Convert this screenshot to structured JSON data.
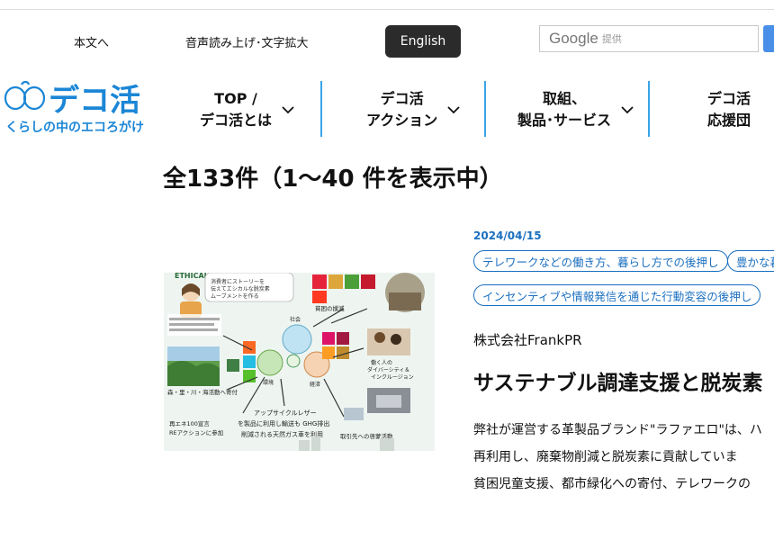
{
  "utility": {
    "skip_link": "本文へ",
    "accessibility_link": "音声読み上げ･文字拡大",
    "english_button": "English",
    "search_brand": "Google",
    "search_suffix": "提供"
  },
  "logo": {
    "text": "デコ活",
    "tagline": "くらしの中のエコろがけ"
  },
  "nav": [
    {
      "line1": "TOP /",
      "line2": "デコ活とは"
    },
    {
      "line1": "デコ活",
      "line2": "アクション"
    },
    {
      "line1": "取組、",
      "line2": "製品･サービス"
    },
    {
      "line1": "デコ活",
      "line2": "応援団"
    }
  ],
  "results": {
    "title": "全133件（1〜40 件を表示中）"
  },
  "article": {
    "date": "2024/04/15",
    "tags": [
      "テレワークなどの働き方、暮らし方での後押し",
      "豊かな暮",
      "インセンティブや情報発信を通じた行動変容の後押し"
    ],
    "company": "株式会社FrankPR",
    "title": "サステナブル調達支援と脱炭素",
    "excerpt": [
      "弊社が運営する革製品ブランド\"ラファエロ\"は、ハ",
      "再利用し、廃棄物削減と脱炭素に貢献していま",
      "貧困児童支援、都市緑化への寄付、テレワークの"
    ],
    "image_labels": {
      "ethical": "ETHICAL",
      "ethical_note": "消費者にストーリーを伝えてエシカルな脱炭素ムーブメントを作る",
      "poverty": "貧困の撲滅",
      "society": "社会",
      "environment": "環境",
      "economy": "経済",
      "diversity": "働く人の ダイバーシティ＆ インクルージョン",
      "forest": "森・里・川・海活動へ寄付",
      "upcycle": "アップサイクルレザーを製品に利用し輸送も GHG排出削減される天然ガス車を利用",
      "re100": "再エネ100宣言 REアクションに参加",
      "business": "取引先への啓蒙活動"
    }
  },
  "colors": {
    "accent_blue": "#1a6fc0",
    "logo_blue": "#1b86d6",
    "nav_divider": "#3aa4e8",
    "english_bg": "#2b2b2b"
  }
}
